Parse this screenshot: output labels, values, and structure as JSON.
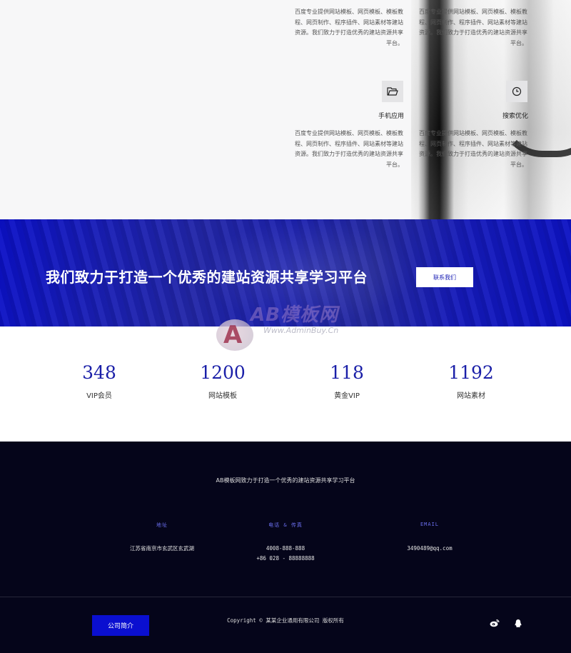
{
  "services": {
    "items": [
      {
        "title": "",
        "desc": "百度专业提供网站模板、网页模板、模板教程、网页制作、程序插件、网站素材等建站资源。我们致力于打造优秀的建站资源共享平台。",
        "icon": ""
      },
      {
        "title": "",
        "desc": "百度专业提供网站模板、网页模板、模板教程、网页制作、程序插件、网站素材等建站资源。我们致力于打造优秀的建站资源共享平台。",
        "icon": ""
      },
      {
        "title": "手机应用",
        "desc": "百度专业提供网站模板、网页模板、模板教程、网页制作、程序插件、网站素材等建站资源。我们致力于打造优秀的建站资源共享平台。",
        "icon": "folder-icon"
      },
      {
        "title": "搜索优化",
        "desc": "百度专业提供网站模板、网页模板、模板教程、网页制作、程序插件、网站素材等建站资源。我们致力于打造优秀的建站资源共享平台。",
        "icon": "clock-icon"
      }
    ]
  },
  "banner": {
    "title": "我们致力于打造一个优秀的建站资源共享学习平台",
    "button_label": "联系我们"
  },
  "stats": [
    {
      "value": "348",
      "label": "VIP会员"
    },
    {
      "value": "1200",
      "label": "网站模板"
    },
    {
      "value": "118",
      "label": "黄金VIP"
    },
    {
      "value": "1192",
      "label": "网站素材"
    }
  ],
  "watermark": {
    "text": "AB模板网",
    "url": "Www.AdminBuy.Cn"
  },
  "footer": {
    "slogan": "AB模板网致力于打造一个优秀的建站资源共享学习平台",
    "columns": [
      {
        "heading": "地址",
        "lines": [
          "江苏省南京市玄武区玄武湖"
        ]
      },
      {
        "heading": "电话 & 传真",
        "lines": [
          "4008-888-888",
          "+86 028 - 88888888"
        ]
      },
      {
        "heading": "EMAIL",
        "lines": [
          "3490489@qq.com"
        ]
      }
    ],
    "about_button": "公司简介",
    "copyright": "Copyright © 某某企业通用有限公司 版权所有",
    "social": [
      "weibo-icon",
      "qq-icon"
    ]
  },
  "colors": {
    "brand_blue": "#1a1fb4",
    "stat_number": "#1a1fa8",
    "footer_bg": "#05051a",
    "footer_heading": "#6b6ff0",
    "footer_button": "#0a0fd0"
  }
}
